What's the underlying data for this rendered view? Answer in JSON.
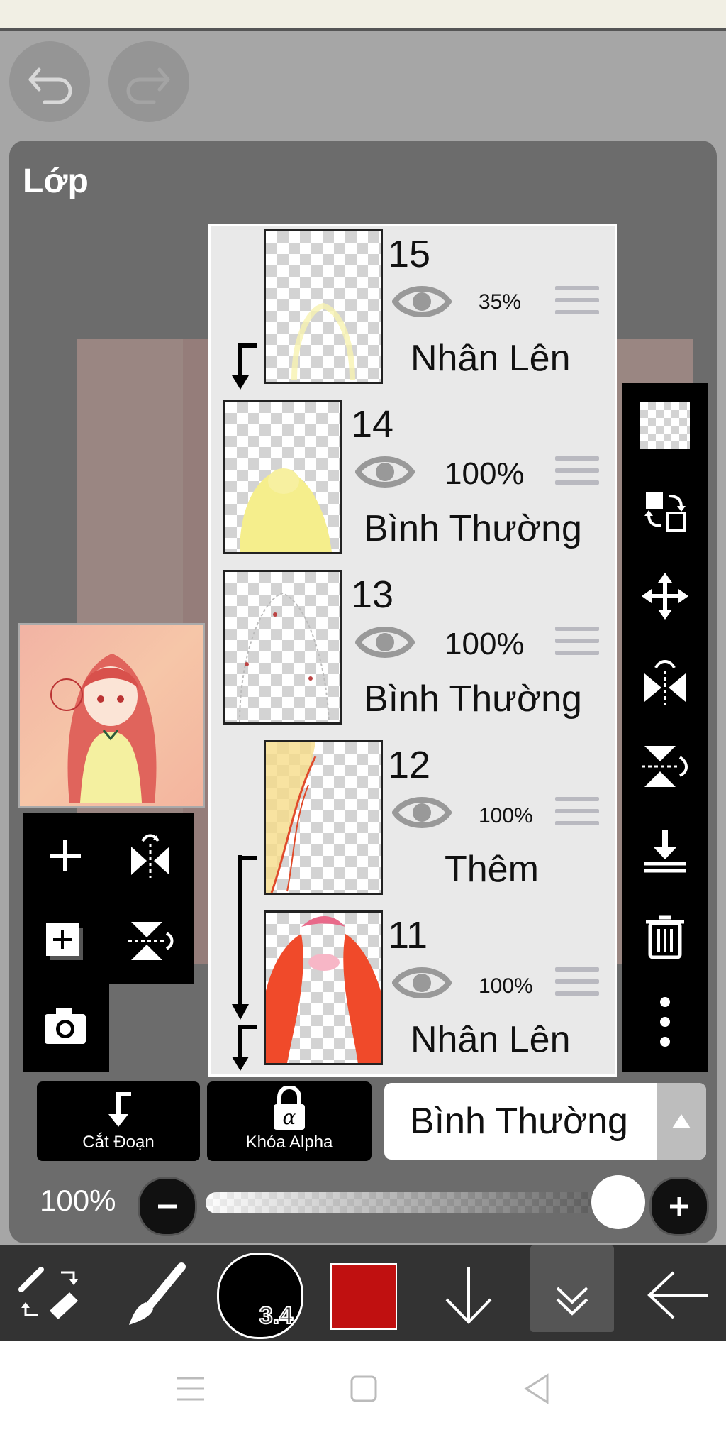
{
  "panel": {
    "title": "Lớp"
  },
  "layers": [
    {
      "number": "15",
      "opacity": "35%",
      "blend_mode": "Nhân Lên",
      "clipped": true
    },
    {
      "number": "14",
      "opacity": "100%",
      "blend_mode": "Bình Thường",
      "clipped": false
    },
    {
      "number": "13",
      "opacity": "100%",
      "blend_mode": "Bình Thường",
      "clipped": false
    },
    {
      "number": "12",
      "opacity": "100%",
      "blend_mode": "Thêm",
      "clipped": true
    },
    {
      "number": "11",
      "opacity": "100%",
      "blend_mode": "Nhân Lên",
      "clipped": true
    }
  ],
  "actions": {
    "clipping_label": "Cắt Đoạn",
    "alpha_lock_label": "Khóa Alpha"
  },
  "blend": {
    "selected": "Bình Thường"
  },
  "opacity": {
    "label": "100%",
    "value": 1.0
  },
  "brush": {
    "size": "3.4"
  },
  "colors": {
    "current": "#c01010",
    "panel_bg": "#6c6c6c",
    "accent": "#000000"
  }
}
